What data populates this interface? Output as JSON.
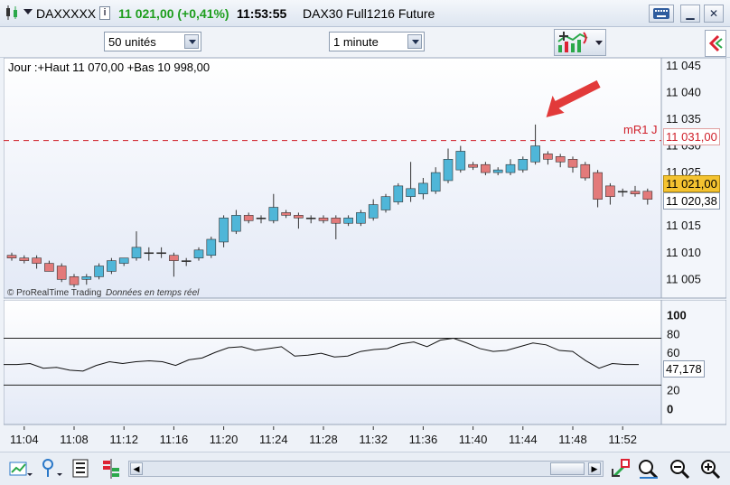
{
  "titlebar": {
    "symbol": "DAXXXXX",
    "info_icon": "info-icon",
    "price": "11 021,00 (+0,41%)",
    "time": "11:53:55",
    "instrument": "DAX30 Full1216 Future",
    "price_color": "#1e9e1e"
  },
  "toolbar": {
    "units_value": "50 unités",
    "interval_value": "1 minute"
  },
  "chart": {
    "header_text": "Jour :+Haut 11 070,00 +Bas 10 998,00",
    "watermark_brand": "© ProRealTime Trading",
    "watermark_note": "Données en temps réel",
    "mr1_label": "mR1 J",
    "mr1_value": "11 031,00",
    "last_price": "11 021,00",
    "cursor_price": "11 020,38",
    "up_color": "#4fb6d8",
    "down_color": "#e37a7a",
    "mr1_color": "#d0202a",
    "arrow_color": "#e23a3a"
  },
  "indicator": {
    "current_value": "47,178"
  },
  "chart_data": [
    {
      "type": "candlestick",
      "title": "",
      "x_tick_labels": [
        "11:04",
        "11:08",
        "11:12",
        "11:16",
        "11:20",
        "11:24",
        "11:28",
        "11:32",
        "11:36",
        "11:40",
        "11:44",
        "11:48",
        "11:52"
      ],
      "y_tick_labels": [
        "11 045",
        "11 040",
        "11 035",
        "11 030",
        "11 025",
        "11 020",
        "11 015",
        "11 010",
        "11 005"
      ],
      "ylim": [
        11001.5,
        11046.5
      ],
      "horizontal_line": {
        "label": "mR1 J",
        "value": 11031.0
      },
      "candles": [
        {
          "t": "11:03",
          "o": 11009.5,
          "h": 11010.0,
          "l": 11008.5,
          "c": 11009.0
        },
        {
          "t": "11:04",
          "o": 11009.0,
          "h": 11009.5,
          "l": 11008.0,
          "c": 11008.5
        },
        {
          "t": "11:05",
          "o": 11009.0,
          "h": 11009.5,
          "l": 11007.0,
          "c": 11008.0
        },
        {
          "t": "11:06",
          "o": 11008.0,
          "h": 11008.5,
          "l": 11006.5,
          "c": 11006.5
        },
        {
          "t": "11:07",
          "o": 11007.5,
          "h": 11008.0,
          "l": 11004.5,
          "c": 11005.0
        },
        {
          "t": "11:08",
          "o": 11005.5,
          "h": 11006.0,
          "l": 11003.5,
          "c": 11004.0
        },
        {
          "t": "11:09",
          "o": 11005.0,
          "h": 11006.0,
          "l": 11004.0,
          "c": 11005.5
        },
        {
          "t": "11:10",
          "o": 11005.5,
          "h": 11008.0,
          "l": 11005.0,
          "c": 11007.5
        },
        {
          "t": "11:11",
          "o": 11006.5,
          "h": 11009.0,
          "l": 11006.0,
          "c": 11008.5
        },
        {
          "t": "11:12",
          "o": 11008.0,
          "h": 11009.0,
          "l": 11007.5,
          "c": 11009.0
        },
        {
          "t": "11:13",
          "o": 11009.0,
          "h": 11014.0,
          "l": 11008.5,
          "c": 11011.0
        },
        {
          "t": "11:14",
          "o": 11010.0,
          "h": 11011.0,
          "l": 11008.5,
          "c": 11010.0
        },
        {
          "t": "11:15",
          "o": 11010.0,
          "h": 11011.0,
          "l": 11009.0,
          "c": 11010.0
        },
        {
          "t": "11:16",
          "o": 11009.5,
          "h": 11010.0,
          "l": 11005.5,
          "c": 11008.5
        },
        {
          "t": "11:17",
          "o": 11008.5,
          "h": 11009.0,
          "l": 11007.5,
          "c": 11008.5
        },
        {
          "t": "11:18",
          "o": 11009.0,
          "h": 11011.0,
          "l": 11008.5,
          "c": 11010.5
        },
        {
          "t": "11:19",
          "o": 11009.5,
          "h": 11013.0,
          "l": 11009.0,
          "c": 11012.5
        },
        {
          "t": "11:20",
          "o": 11012.0,
          "h": 11017.0,
          "l": 11011.0,
          "c": 11016.5
        },
        {
          "t": "11:21",
          "o": 11014.0,
          "h": 11018.0,
          "l": 11013.5,
          "c": 11017.0
        },
        {
          "t": "11:22",
          "o": 11017.0,
          "h": 11017.5,
          "l": 11015.5,
          "c": 11016.0
        },
        {
          "t": "11:23",
          "o": 11016.5,
          "h": 11017.0,
          "l": 11015.5,
          "c": 11016.5
        },
        {
          "t": "11:24",
          "o": 11016.0,
          "h": 11021.0,
          "l": 11015.5,
          "c": 11018.5
        },
        {
          "t": "11:25",
          "o": 11017.5,
          "h": 11018.0,
          "l": 11016.5,
          "c": 11017.0
        },
        {
          "t": "11:26",
          "o": 11017.0,
          "h": 11017.5,
          "l": 11014.5,
          "c": 11016.5
        },
        {
          "t": "11:27",
          "o": 11016.5,
          "h": 11017.0,
          "l": 11015.5,
          "c": 11016.5
        },
        {
          "t": "11:28",
          "o": 11016.5,
          "h": 11017.0,
          "l": 11015.5,
          "c": 11016.0
        },
        {
          "t": "11:29",
          "o": 11016.5,
          "h": 11017.0,
          "l": 11012.5,
          "c": 11015.5
        },
        {
          "t": "11:30",
          "o": 11015.5,
          "h": 11017.0,
          "l": 11015.0,
          "c": 11016.5
        },
        {
          "t": "11:31",
          "o": 11015.5,
          "h": 11018.0,
          "l": 11015.0,
          "c": 11017.5
        },
        {
          "t": "11:32",
          "o": 11016.5,
          "h": 11020.0,
          "l": 11016.0,
          "c": 11019.0
        },
        {
          "t": "11:33",
          "o": 11018.0,
          "h": 11021.0,
          "l": 11017.5,
          "c": 11020.5
        },
        {
          "t": "11:34",
          "o": 11019.5,
          "h": 11023.0,
          "l": 11019.0,
          "c": 11022.5
        },
        {
          "t": "11:35",
          "o": 11020.5,
          "h": 11027.0,
          "l": 11019.5,
          "c": 11022.0
        },
        {
          "t": "11:36",
          "o": 11021.0,
          "h": 11024.0,
          "l": 11020.0,
          "c": 11023.0
        },
        {
          "t": "11:37",
          "o": 11021.5,
          "h": 11026.0,
          "l": 11021.0,
          "c": 11025.0
        },
        {
          "t": "11:38",
          "o": 11023.5,
          "h": 11029.5,
          "l": 11023.0,
          "c": 11027.5
        },
        {
          "t": "11:39",
          "o": 11025.5,
          "h": 11030.0,
          "l": 11025.0,
          "c": 11029.0
        },
        {
          "t": "11:40",
          "o": 11026.5,
          "h": 11027.0,
          "l": 11025.5,
          "c": 11026.0
        },
        {
          "t": "11:41",
          "o": 11026.5,
          "h": 11027.0,
          "l": 11024.5,
          "c": 11025.0
        },
        {
          "t": "11:42",
          "o": 11025.0,
          "h": 11026.0,
          "l": 11024.5,
          "c": 11025.5
        },
        {
          "t": "11:43",
          "o": 11025.0,
          "h": 11027.5,
          "l": 11024.5,
          "c": 11026.5
        },
        {
          "t": "11:44",
          "o": 11025.5,
          "h": 11028.0,
          "l": 11025.0,
          "c": 11027.5
        },
        {
          "t": "11:45",
          "o": 11027.0,
          "h": 11034.0,
          "l": 11026.5,
          "c": 11030.0
        },
        {
          "t": "11:46",
          "o": 11028.5,
          "h": 11029.0,
          "l": 11026.5,
          "c": 11027.5
        },
        {
          "t": "11:47",
          "o": 11028.0,
          "h": 11028.5,
          "l": 11026.0,
          "c": 11027.0
        },
        {
          "t": "11:48",
          "o": 11027.5,
          "h": 11028.0,
          "l": 11025.0,
          "c": 11026.0
        },
        {
          "t": "11:49",
          "o": 11026.5,
          "h": 11027.0,
          "l": 11023.5,
          "c": 11024.0
        },
        {
          "t": "11:50",
          "o": 11025.0,
          "h": 11025.5,
          "l": 11018.5,
          "c": 11020.0
        },
        {
          "t": "11:51",
          "o": 11022.5,
          "h": 11023.0,
          "l": 11019.0,
          "c": 11020.5
        },
        {
          "t": "11:52",
          "o": 11021.5,
          "h": 11022.0,
          "l": 11020.5,
          "c": 11021.5
        },
        {
          "t": "11:53",
          "o": 11021.5,
          "h": 11022.5,
          "l": 11020.5,
          "c": 11021.0
        },
        {
          "t": "11:54",
          "o": 11021.5,
          "h": 11022.0,
          "l": 11019.0,
          "c": 11020.0
        }
      ]
    },
    {
      "type": "line",
      "title": "",
      "y_tick_labels": [
        "100",
        "80",
        "60",
        "40",
        "20",
        "0"
      ],
      "ylim": [
        0,
        100
      ],
      "reference_lines": [
        75,
        25
      ],
      "series": [
        {
          "name": "",
          "values": [
            47,
            47,
            48,
            43,
            44,
            41,
            40,
            46,
            50,
            48,
            50,
            51,
            50,
            46,
            52,
            54,
            60,
            65,
            66,
            62,
            64,
            66,
            56,
            57,
            59,
            55,
            56,
            61,
            63,
            64,
            69,
            71,
            66,
            73,
            75,
            70,
            64,
            61,
            62,
            66,
            70,
            68,
            62,
            61,
            51,
            43,
            48,
            47,
            47
          ]
        }
      ]
    }
  ]
}
